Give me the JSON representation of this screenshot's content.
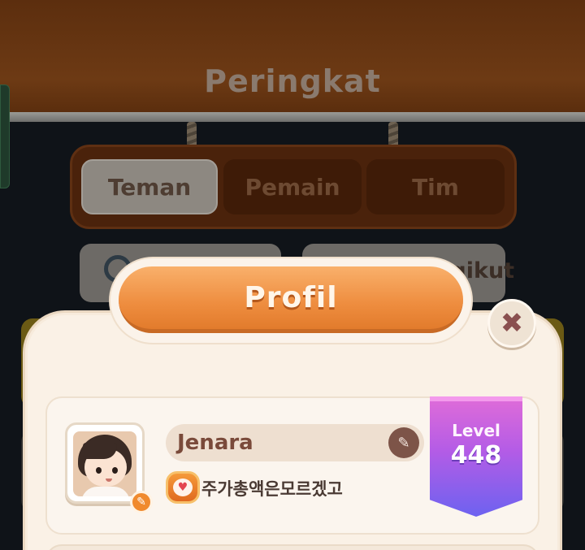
{
  "background": {
    "page_title": "Peringkat",
    "tabs": [
      {
        "label": "Teman",
        "active": true
      },
      {
        "label": "Pemain",
        "active": false
      },
      {
        "label": "Tim",
        "active": false
      }
    ],
    "follow_label": "Mengikut"
  },
  "dialog": {
    "title": "Profil",
    "close_icon": "close-icon"
  },
  "profile": {
    "name": "Jenara",
    "team_name": "주가총액은모르겠고",
    "level_label": "Level",
    "level_value": "448"
  },
  "colors": {
    "header_orange": "#ee8d3f",
    "level_top": "#e06cd8",
    "level_bottom": "#6d62f0",
    "dialog_bg": "#faf1e6"
  }
}
